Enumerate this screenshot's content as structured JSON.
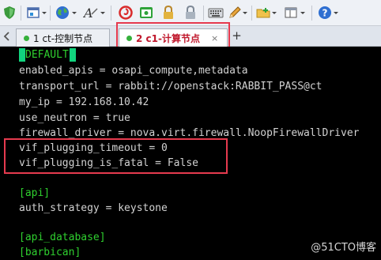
{
  "toolbar": {
    "icons": [
      "shield-icon",
      "window-icon",
      "globe-icon",
      "font-icon",
      "swirl-icon",
      "terminal-icon",
      "lock-icon",
      "keyboard-icon",
      "pencil-icon",
      "new-folder-icon",
      "layout-icon",
      "help-icon"
    ],
    "colors": {
      "green": "#2fa33a",
      "red": "#d92b2b",
      "blue": "#2f6fd1",
      "brown": "#a35c1e"
    }
  },
  "tabs": [
    {
      "label": "1 ct-控制节点",
      "active": false,
      "status_color": "#35b03b"
    },
    {
      "label": "2 c1-计算节点",
      "active": true,
      "status_color": "#35b03b",
      "close_label": "×"
    }
  ],
  "new_tab_label": "+",
  "terminal": {
    "lines": [
      {
        "text": "DEFAULT",
        "color": "green"
      },
      {
        "text": "enabled_apis = osapi_compute,metadata",
        "color": "white"
      },
      {
        "text": "transport_url = rabbit://openstack:RABBIT_PASS@ct",
        "color": "white"
      },
      {
        "text": "my_ip = 192.168.10.42",
        "color": "white"
      },
      {
        "text": "use_neutron = true",
        "color": "white"
      },
      {
        "text": "firewall_driver = nova.virt.firewall.NoopFirewallDriver",
        "color": "white"
      },
      {
        "text": "vif_plugging_timeout = 0",
        "color": "white"
      },
      {
        "text": "vif_plugging_is_fatal = False",
        "color": "white"
      },
      {
        "text": "",
        "color": "white"
      },
      {
        "text": "[api]",
        "color": "green"
      },
      {
        "text": "auth_strategy = keystone",
        "color": "white"
      },
      {
        "text": "",
        "color": "white"
      },
      {
        "text": "[api_database]",
        "color": "green"
      },
      {
        "text": "[barbican]",
        "color": "green"
      }
    ],
    "cursor_color": "#11d47e",
    "highlight_color": "#e63a4e"
  },
  "watermark": "@51CTO博客"
}
